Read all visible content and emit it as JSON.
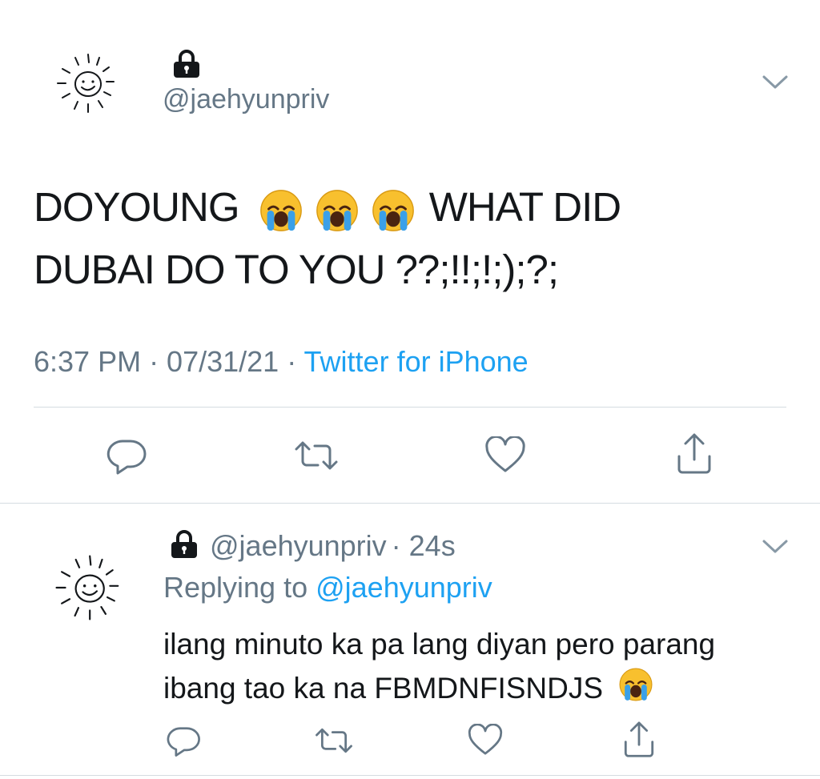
{
  "main_tweet": {
    "avatar_icon": "sun-doodle-icon",
    "lock_icon": "lock-icon",
    "handle": "@jaehyunpriv",
    "text_line1_a": "DOYOUNG",
    "text_line1_b": "WHAT DID",
    "text_line2": "DUBAI DO TO YOU ??;!!;!;);?;",
    "emoji": "loudly-crying-face",
    "timestamp": "6:37 PM · 07/31/21 · ",
    "source": "Twitter for iPhone",
    "actions": [
      "reply-icon",
      "retweet-icon",
      "like-icon",
      "share-icon"
    ]
  },
  "reply_tweet": {
    "avatar_icon": "sun-doodle-icon",
    "lock_icon": "lock-icon",
    "handle": "@jaehyunpriv",
    "meta": "· 24s",
    "replying_prefix": "Replying to ",
    "replying_handle": "@jaehyunpriv",
    "text_line1": "ilang minuto ka pa lang diyan pero parang",
    "text_line2": "ibang tao ka na FBMDNFISNDJS",
    "emoji": "loudly-crying-face"
  },
  "colors": {
    "accent": "#1da1f2",
    "muted": "#657786",
    "divider": "#d5dce1",
    "text": "#14171a"
  }
}
